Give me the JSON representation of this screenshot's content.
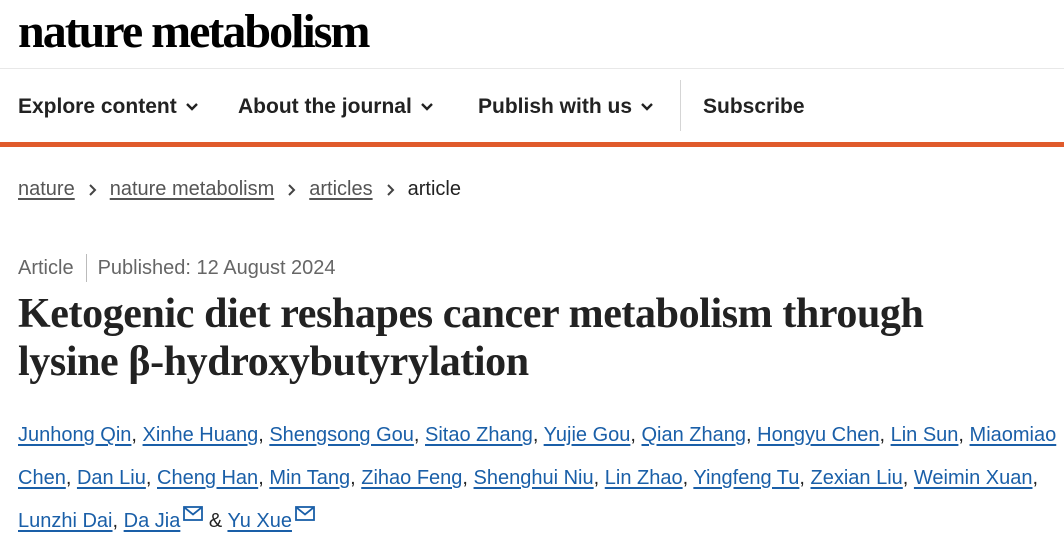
{
  "site": {
    "logo": "nature metabolism"
  },
  "nav": {
    "items": [
      {
        "label": "Explore content"
      },
      {
        "label": "About the journal"
      },
      {
        "label": "Publish with us"
      }
    ],
    "subscribe": "Subscribe"
  },
  "breadcrumb": [
    "nature",
    "nature metabolism",
    "articles",
    "article"
  ],
  "article": {
    "type": "Article",
    "published": "Published: 12 August 2024",
    "title_line1": "Ketogenic diet reshapes cancer metabolism through",
    "title_line2": "lysine β-hydroxybutyrylation",
    "authors": [
      "Junhong Qin",
      "Xinhe Huang",
      "Shengsong Gou",
      "Sitao Zhang",
      "Yujie Gou",
      "Qian Zhang",
      "Hongyu Chen",
      "Lin Sun",
      "Miaomiao Chen",
      "Dan Liu",
      "Cheng Han",
      "Min Tang",
      "Zihao Feng",
      "Shenghui Niu",
      "Lin Zhao",
      "Yingfeng Tu",
      "Zexian Liu",
      "Weimin Xuan",
      "Lunzhi Dai",
      "Da Jia",
      "Yu Xue"
    ],
    "ampersand": "&",
    "comma": ",",
    "corresponding_icon": "mail-icon"
  },
  "colors": {
    "accent": "#e05a2b",
    "link": "#1a5fa8"
  }
}
